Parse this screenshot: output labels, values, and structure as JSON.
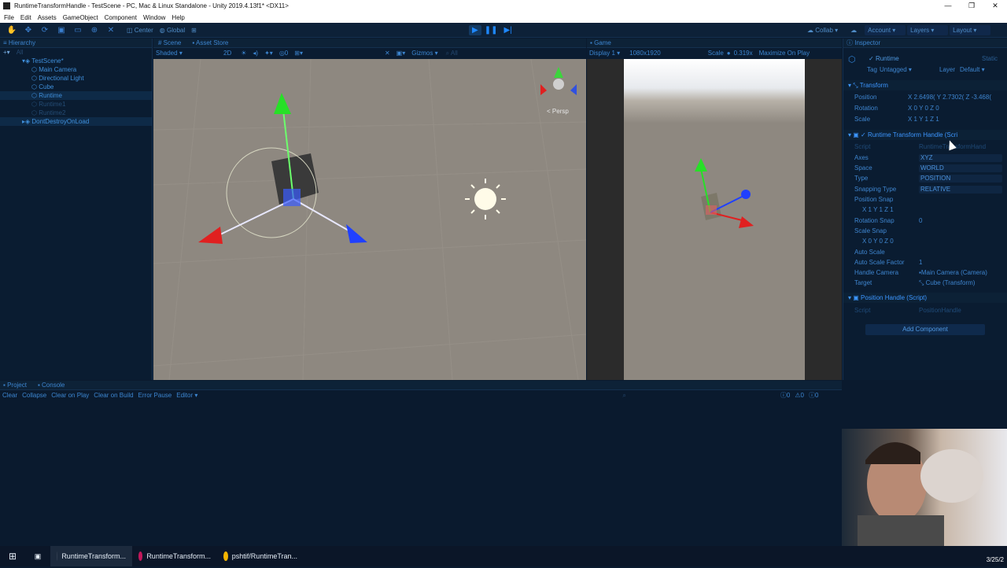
{
  "window": {
    "title": "RuntimeTransformHandle - TestScene - PC, Mac & Linux Standalone - Unity 2019.4.13f1* <DX11>",
    "controls": [
      "—",
      "❐",
      "✕"
    ]
  },
  "menu": [
    "File",
    "Edit",
    "Assets",
    "GameObject",
    "Component",
    "Window",
    "Help"
  ],
  "toolbar": {
    "center_label": "Center",
    "global_label": "Global",
    "collab_label": "Collab",
    "account_label": "Account",
    "layers_label": "Layers",
    "layout_label": "Layout"
  },
  "hierarchy": {
    "tab": "Hierarchy",
    "search_placeholder": "All",
    "items": [
      {
        "label": "TestScene*"
      },
      {
        "label": "Main Camera"
      },
      {
        "label": "Directional Light"
      },
      {
        "label": "Cube"
      },
      {
        "label": "Runtime"
      },
      {
        "label": "Runtime1"
      },
      {
        "label": "Runtime2"
      },
      {
        "label": "DontDestroyOnLoad"
      }
    ]
  },
  "scene": {
    "tabs": [
      "Scene",
      "Asset Store"
    ],
    "shading": "Shaded",
    "mode_2d": "2D",
    "gizmos": "Gizmos",
    "search_placeholder": "All",
    "persp_label": "Persp"
  },
  "game": {
    "tab": "Game",
    "display": "Display 1",
    "resolution": "1080x1920",
    "scale_label": "Scale",
    "scale_value": "0.319x",
    "maximize_label": "Maximize On Play"
  },
  "inspector": {
    "tab": "Inspector",
    "object_name": "Runtime",
    "static_label": "Static",
    "tag_label": "Tag",
    "tag_value": "Untagged",
    "layer_label": "Layer",
    "layer_value": "Default",
    "transform": {
      "header": "Transform",
      "position_label": "Position",
      "position": "X 2.6498( Y 2.7302( Z -3.468(",
      "rotation_label": "Rotation",
      "rotation": "X 0        Y 0        Z 0",
      "scale_label": "Scale",
      "scale": "X 1        Y 1        Z 1"
    },
    "rth": {
      "header": "Runtime Transform Handle (Scri",
      "script_label": "Script",
      "script_value": "RuntimeTransformHand",
      "axes_label": "Axes",
      "axes_value": "XYZ",
      "space_label": "Space",
      "space_value": "WORLD",
      "type_label": "Type",
      "type_value": "POSITION",
      "snapping_label": "Snapping Type",
      "snapping_value": "RELATIVE",
      "pos_snap_label": "Position Snap",
      "pos_snap": "X 1        Y 1        Z 1",
      "rot_snap_label": "Rotation Snap",
      "rot_snap": "0",
      "scale_snap_label": "Scale Snap",
      "scale_snap": "X 0        Y 0        Z 0",
      "auto_scale_label": "Auto Scale",
      "auto_scale_factor_label": "Auto Scale Factor",
      "auto_scale_factor": "1",
      "handle_camera_label": "Handle Camera",
      "handle_camera": "Main Camera (Camera)",
      "target_label": "Target",
      "target": "Cube (Transform)"
    },
    "position_handle": {
      "header": "Position Handle (Script)",
      "script_label": "Script",
      "script_value": "PositionHandle"
    },
    "add_component": "Add Component"
  },
  "console": {
    "tabs": [
      "Project",
      "Console"
    ],
    "buttons": [
      "Clear",
      "Collapse",
      "Clear on Play",
      "Clear on Build",
      "Error Pause",
      "Editor"
    ],
    "counts": [
      "0",
      "0",
      "0"
    ]
  },
  "taskbar": {
    "items": [
      {
        "label": "RuntimeTransform...",
        "color": "#2f3c4e"
      },
      {
        "label": "RuntimeTransform...",
        "color": "#c2185b"
      },
      {
        "label": "pshtif/RuntimeTran...",
        "color": "#f4b400"
      }
    ],
    "date": "3/25/2"
  }
}
